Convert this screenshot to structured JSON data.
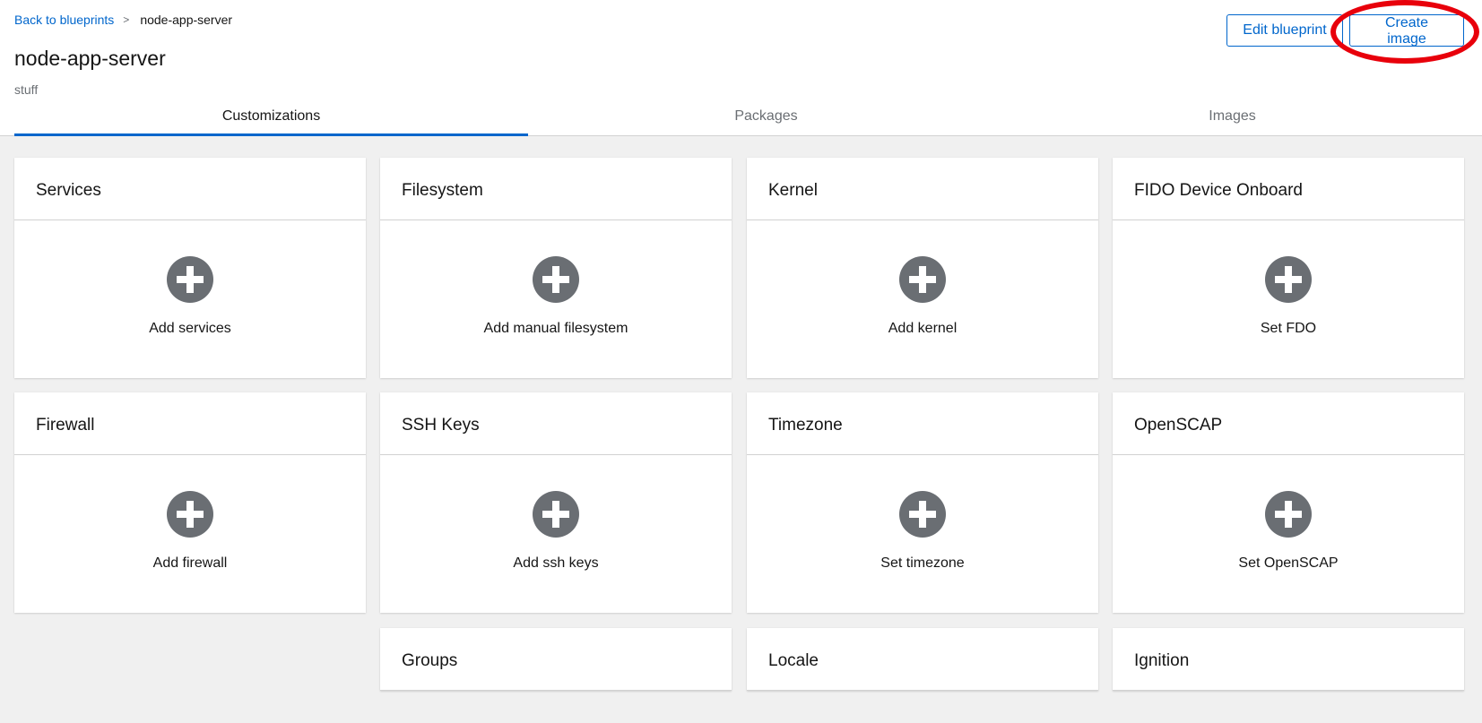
{
  "breadcrumb": {
    "back_label": "Back to blueprints",
    "separator": ">",
    "current": "node-app-server"
  },
  "page": {
    "title": "node-app-server",
    "description": "stuff"
  },
  "actions": {
    "edit_label": "Edit blueprint",
    "create_label": "Create image"
  },
  "tabs": [
    {
      "label": "Customizations",
      "active": true
    },
    {
      "label": "Packages",
      "active": false
    },
    {
      "label": "Images",
      "active": false
    }
  ],
  "cards": [
    {
      "title": "Services",
      "action": "Add services"
    },
    {
      "title": "Filesystem",
      "action": "Add manual filesystem"
    },
    {
      "title": "Kernel",
      "action": "Add kernel"
    },
    {
      "title": "FIDO Device Onboard",
      "action": "Set FDO"
    },
    {
      "title": "Firewall",
      "action": "Add firewall"
    },
    {
      "title": "SSH Keys",
      "action": "Add ssh keys"
    },
    {
      "title": "Timezone",
      "action": "Set timezone"
    },
    {
      "title": "OpenSCAP",
      "action": "Set OpenSCAP"
    },
    {
      "title": "Groups",
      "action": ""
    },
    {
      "title": "Locale",
      "action": ""
    },
    {
      "title": "Ignition",
      "action": ""
    }
  ],
  "colors": {
    "accent": "#0066cc",
    "annotation": "#e8000b",
    "icon": "#6a6e73"
  },
  "icons": {
    "add": "plus-circle-icon",
    "breadcrumb_separator": "chevron-right-icon"
  }
}
